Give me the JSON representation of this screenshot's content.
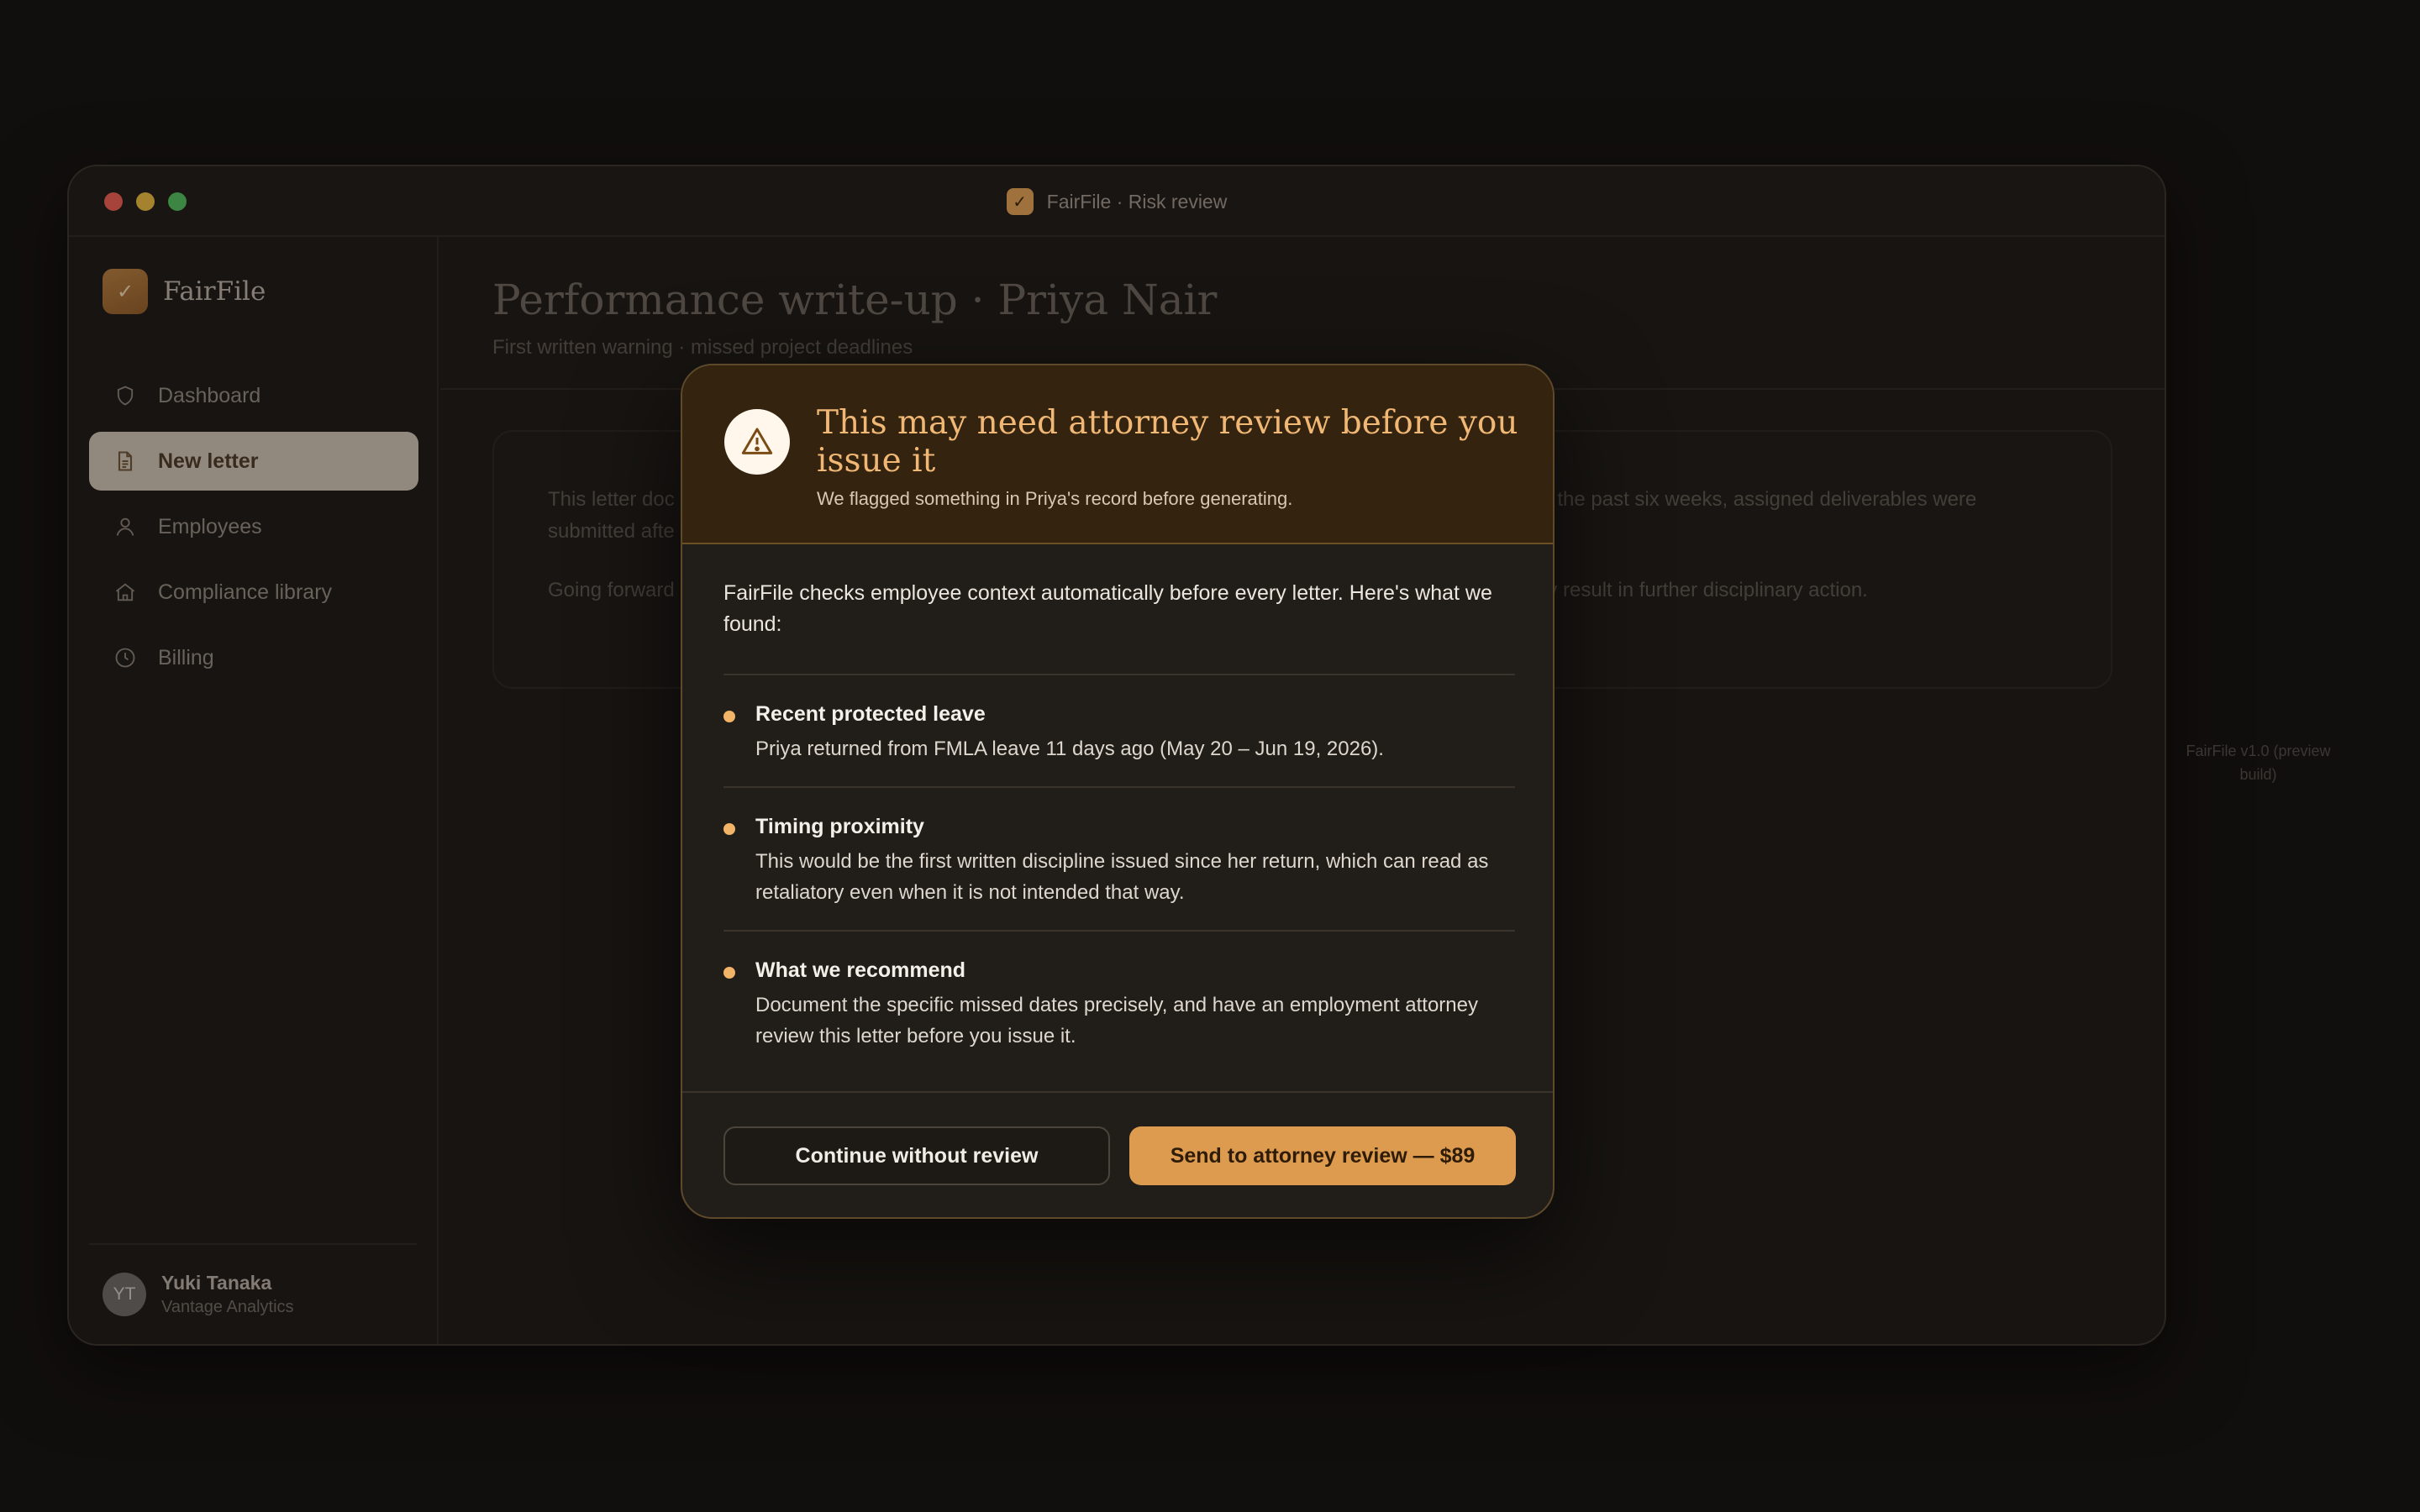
{
  "window": {
    "title": "FairFile · Risk review"
  },
  "sidebar": {
    "brand": "FairFile",
    "items": [
      {
        "label": "Dashboard",
        "icon": "shield-icon"
      },
      {
        "label": "New letter",
        "icon": "document-icon",
        "active": true
      },
      {
        "label": "Employees",
        "icon": "person-icon"
      },
      {
        "label": "Compliance library",
        "icon": "building-icon"
      },
      {
        "label": "Billing",
        "icon": "clock-icon"
      }
    ],
    "user": {
      "initials": "YT",
      "name": "Yuki Tanaka",
      "org": "Vantage Analytics"
    }
  },
  "main": {
    "title": "Performance write-up · Priya Nair",
    "subtitle": "First written warning · missed project deadlines",
    "letter": {
      "p1_left": "This letter doc",
      "p1_left2": "submitted afte",
      "p1_right": "in the past six weeks, assigned deliverables were",
      "p2_left": "Going forward",
      "p2_right": "ay result in further disciplinary action."
    }
  },
  "version_note": "FairFile v1.0 (preview build)",
  "modal": {
    "title": "This may need attorney review before you issue it",
    "subtitle": "We flagged something in Priya's record before generating.",
    "intro": "FairFile checks employee context automatically before every letter. Here's what we found:",
    "findings": [
      {
        "title": "Recent protected leave",
        "text": "Priya returned from FMLA leave 11 days ago (May 20 – Jun 19, 2026)."
      },
      {
        "title": "Timing proximity",
        "text": "This would be the first written discipline issued since her return, which can read as retaliatory even when it is not intended that way."
      },
      {
        "title": "What we recommend",
        "text": "Document the specific missed dates precisely, and have an employment attorney review this letter before you issue it."
      }
    ],
    "secondary_button": "Continue without review",
    "primary_button": "Send to attorney review — $89"
  },
  "colors": {
    "accent": "#dc9b4e",
    "warning_title": "#f1b774",
    "modal_header_bg": "#33230f",
    "background": "#141210"
  }
}
